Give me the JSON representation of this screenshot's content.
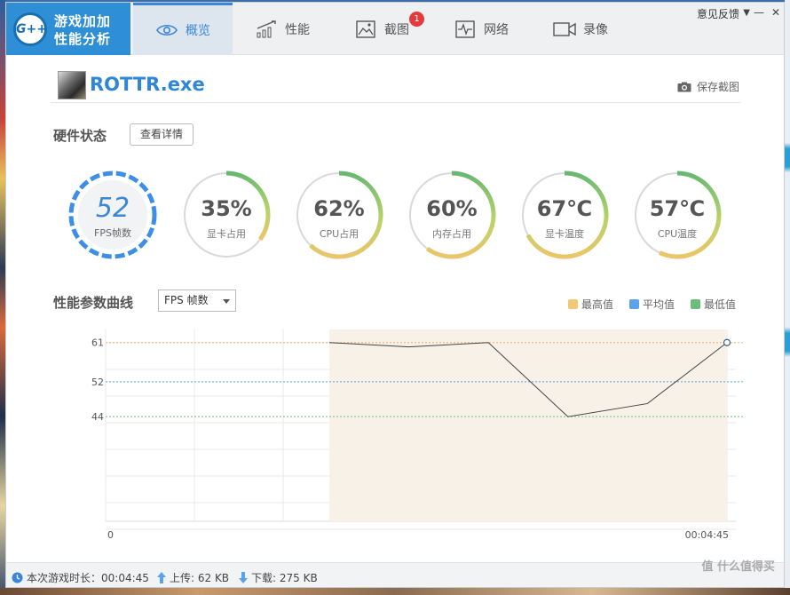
{
  "logo": {
    "badge": "G++",
    "line1": "游戏加加",
    "line2": "性能分析"
  },
  "tabs": [
    {
      "label": "概览",
      "active": true
    },
    {
      "label": "性能",
      "active": false
    },
    {
      "label": "截图",
      "active": false,
      "badge": "1"
    },
    {
      "label": "网络",
      "active": false
    },
    {
      "label": "录像",
      "active": false
    }
  ],
  "window": {
    "feedback": "意见反馈",
    "menu": "▼",
    "minimize": "—",
    "close": "✕"
  },
  "game": {
    "title": "ROTTR.exe",
    "save_screenshot": "保存截图"
  },
  "hardware": {
    "title": "硬件状态",
    "details_button": "查看详情"
  },
  "gauges": [
    {
      "value": "52",
      "label": "FPS帧数",
      "type": "fps"
    },
    {
      "value": "35%",
      "label": "显卡占用",
      "fraction": 0.35
    },
    {
      "value": "62%",
      "label": "CPU占用",
      "fraction": 0.62
    },
    {
      "value": "60%",
      "label": "内存占用",
      "fraction": 0.6
    },
    {
      "value": "67℃",
      "label": "显卡温度",
      "fraction": 0.67
    },
    {
      "value": "57℃",
      "label": "CPU温度",
      "fraction": 0.57
    }
  ],
  "curve": {
    "title": "性能参数曲线",
    "select_value": "FPS 帧数",
    "legend": [
      {
        "label": "最高值",
        "color": "#f0c878"
      },
      {
        "label": "平均值",
        "color": "#5aa3ea"
      },
      {
        "label": "最低值",
        "color": "#6bbd7b"
      }
    ]
  },
  "chart_data": {
    "type": "line",
    "series": [
      {
        "values": [
          61,
          60,
          61,
          44,
          47,
          61
        ]
      }
    ],
    "x_start": "0",
    "x_end": "00:04:45",
    "reference_lines": [
      {
        "label": "61",
        "value": 61,
        "color": "#f0b070"
      },
      {
        "label": "52",
        "value": 52,
        "color": "#5aa3ea"
      },
      {
        "label": "44",
        "value": 44,
        "color": "#6bbd7b"
      }
    ],
    "grid": true
  },
  "status": {
    "duration": "本次游戏时长：00:04:45",
    "upload": "上传: 62 KB",
    "download": "下载: 275 KB"
  },
  "watermark": "值 什么值得买"
}
